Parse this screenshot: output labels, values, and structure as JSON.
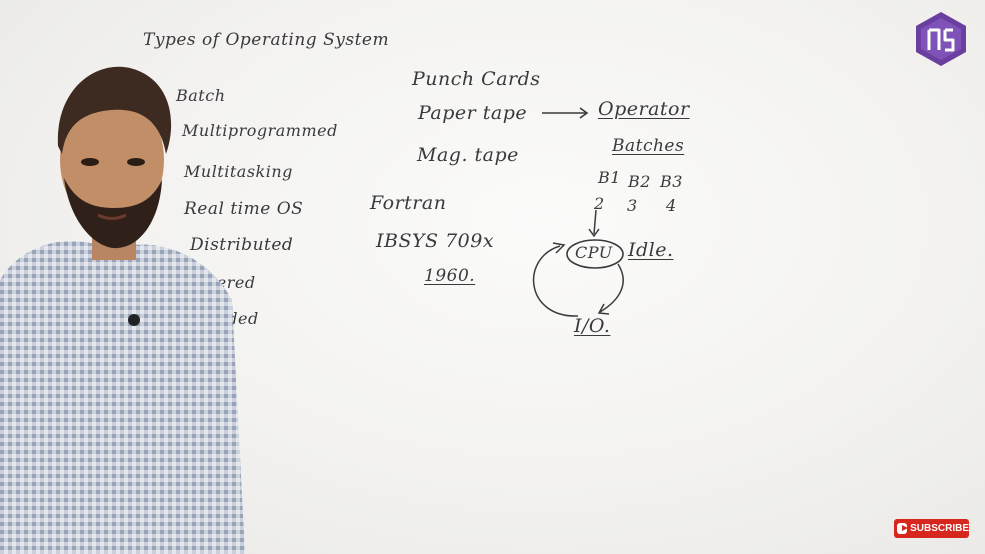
{
  "board": {
    "heading": "Types of Operating System",
    "os_list": [
      "Batch",
      "Multiprogrammed",
      "Multitasking",
      "Real time OS",
      "Distributed",
      "Clustered",
      "Embedded"
    ],
    "media": [
      "Punch Cards",
      "Paper tape",
      "Mag. tape"
    ],
    "operator": "Operator",
    "batches_label": "Batches",
    "batches": [
      "B1",
      "B2",
      "B3"
    ],
    "batch_numbers": [
      "2",
      "3",
      "4"
    ],
    "fortran": "Fortran",
    "ibsys": "IBSYS 709x",
    "year": "1960.",
    "cpu": "CPU",
    "idle": "Idle.",
    "io": "I/O."
  },
  "overlay": {
    "subscribe_label": "SUBSCRIBE",
    "brand_color": "#6b3fa0",
    "subscribe_color": "#d7261e"
  }
}
